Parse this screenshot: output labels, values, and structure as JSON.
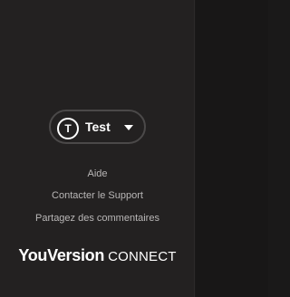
{
  "user": {
    "initial": "T",
    "name": "Test"
  },
  "links": {
    "help": "Aide",
    "support": "Contacter le Support",
    "feedback": "Partagez des commentaires"
  },
  "brand": {
    "name": "YouVersion",
    "product": "CONNECT"
  },
  "icons": {
    "dropdown": "chevron-down-icon"
  },
  "colors": {
    "sidebar_bg": "#232121",
    "main_bg": "#181717",
    "link_text": "#b9b7b7",
    "pill_border": "#4b4949"
  }
}
